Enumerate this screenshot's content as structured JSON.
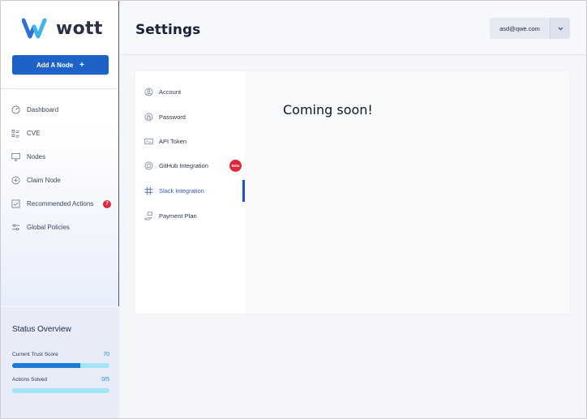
{
  "brand": {
    "name": "wott",
    "accent": "#1d63c7",
    "logo_blue": "#2f6fd6",
    "logo_cyan": "#3fb3ea"
  },
  "sidebar": {
    "add_node_label": "Add A Node",
    "add_node_icon": "plus-icon",
    "items": [
      {
        "label": "Dashboard",
        "icon": "gauge-icon"
      },
      {
        "label": "CVE",
        "icon": "list-icon"
      },
      {
        "label": "Nodes",
        "icon": "monitor-icon"
      },
      {
        "label": "Claim Node",
        "icon": "plus-circle-icon"
      },
      {
        "label": "Recommended Actions",
        "icon": "checkbox-icon",
        "badge": "7"
      },
      {
        "label": "Global Policies",
        "icon": "sliders-icon"
      }
    ]
  },
  "status": {
    "title": "Status Overview",
    "trust_label": "Current Trust Score",
    "trust_value": "70",
    "trust_fraction": 0.7,
    "actions_label": "Actions Solved",
    "actions_value": "0/5",
    "actions_fraction": 0
  },
  "header": {
    "title": "Settings",
    "user_email": "asd@qwe.com",
    "user_chevron_icon": "chevron-down-icon"
  },
  "settings_menu": {
    "items": [
      {
        "label": "Account",
        "icon": "user-circle-icon"
      },
      {
        "label": "Password",
        "icon": "lock-icon"
      },
      {
        "label": "API Token",
        "icon": "token-icon"
      },
      {
        "label": "GitHub Integration",
        "icon": "github-icon",
        "badge": "Beta"
      },
      {
        "label": "Slack Integration",
        "icon": "slack-icon",
        "active": true
      },
      {
        "label": "Payment Plan",
        "icon": "payment-hand-icon"
      }
    ]
  },
  "content": {
    "message": "Coming soon!"
  }
}
